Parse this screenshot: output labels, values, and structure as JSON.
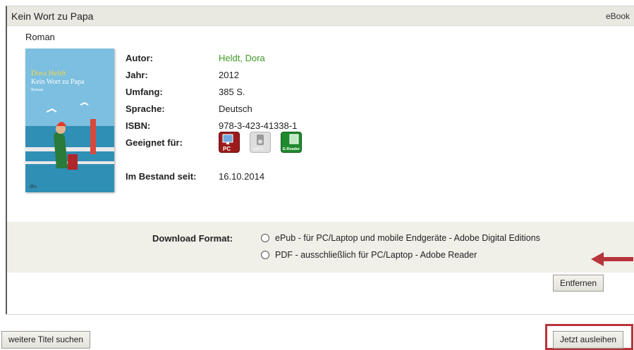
{
  "header": {
    "title": "Kein Wort zu Papa",
    "type": "eBook"
  },
  "subtitle": "Roman",
  "cover": {
    "author": "Dora Heldt",
    "title": "Kein Wort zu Papa",
    "subtitle": "Roman",
    "publisher": "dtv"
  },
  "details": {
    "author_label": "Autor:",
    "author": "Heldt, Dora",
    "year_label": "Jahr:",
    "year": "2012",
    "pages_label": "Umfang:",
    "pages": "385 S.",
    "language_label": "Sprache:",
    "language": "Deutsch",
    "isbn_label": "ISBN:",
    "isbn": "978-3-423-41338-1",
    "suitable_label": "Geeignet für:",
    "devices": [
      "PC",
      "MP3",
      "E-Reader"
    ],
    "since_label": "Im Bestand seit:",
    "since": "16.10.2014"
  },
  "download": {
    "label": "Download Format:",
    "options": [
      "ePub - für PC/Laptop und mobile Endgeräte - Adobe Digital Editions",
      "PDF - ausschließlich für PC/Laptop - Adobe Reader"
    ]
  },
  "buttons": {
    "remove": "Entfernen",
    "search_more": "weitere Titel suchen",
    "borrow": "Jetzt ausleihen"
  },
  "colors": {
    "author_link": "#3f9a26",
    "highlight": "#b8343b",
    "arrow": "#b8343b"
  }
}
